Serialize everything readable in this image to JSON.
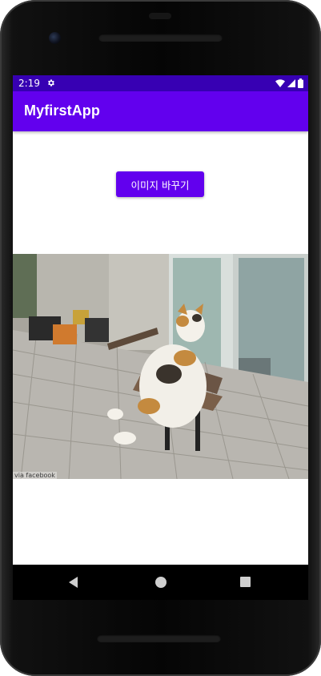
{
  "status_bar": {
    "time": "2:19",
    "icons": [
      "gear-icon",
      "wifi-icon",
      "signal-icon",
      "battery-icon"
    ],
    "background": "#3700b3"
  },
  "app_bar": {
    "title": "MyfirstApp",
    "background": "#6200ee"
  },
  "main": {
    "change_button_label": "이미지 바꾸기",
    "image": {
      "description_icon": "cat-on-bench-photo",
      "watermark": "via facebook"
    }
  },
  "nav_bar": {
    "icons": [
      "back-icon",
      "home-icon",
      "recents-icon"
    ]
  },
  "colors": {
    "primary": "#6200ee",
    "primary_dark": "#3700b3",
    "button_text": "#ffffff"
  }
}
